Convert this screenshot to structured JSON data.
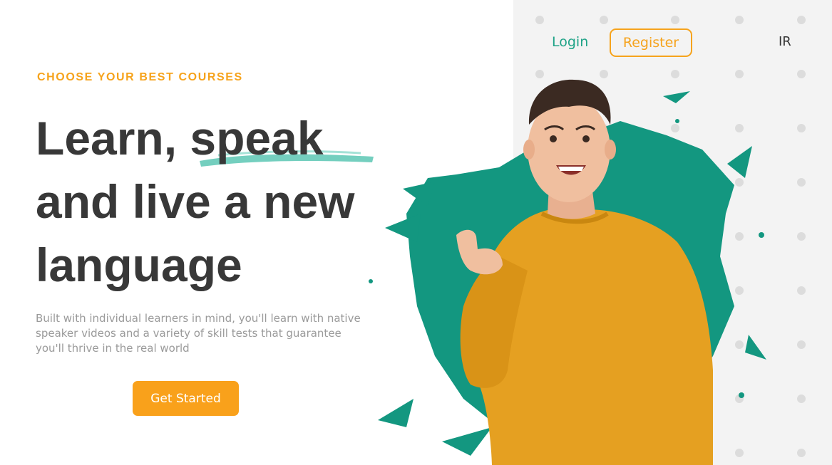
{
  "nav": {
    "login_label": "Login",
    "register_label": "Register",
    "language_label": "IR"
  },
  "hero": {
    "eyebrow": "CHOOSE YOUR BEST COURSES",
    "headline_part1": "Learn, ",
    "headline_highlight": "speak",
    "headline_part2": "and live a new",
    "headline_part3": "language",
    "description": "Built with individual learners in mind, you'll learn with native speaker videos and a variety of skill tests that guarantee you'll thrive in the real world",
    "cta_label": "Get Started"
  },
  "colors": {
    "accent": "#f6a31c",
    "teal": "#1fa387",
    "heading": "#383838",
    "muted_text": "#9a9a9a",
    "panel_bg": "#f3f3f3"
  },
  "icons": {
    "illustration": "smiling-man-pointing-illustration",
    "background": "teal-paint-splash"
  }
}
